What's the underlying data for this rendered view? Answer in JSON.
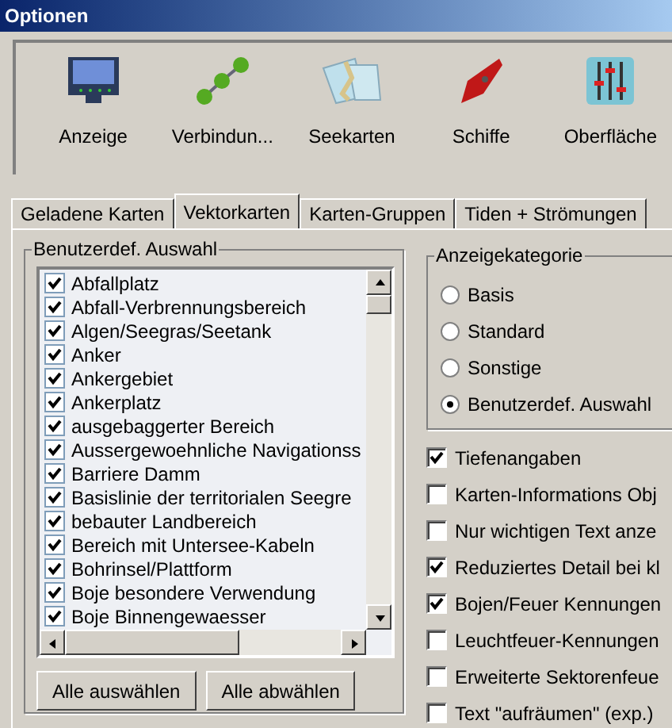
{
  "window": {
    "title": "Optionen"
  },
  "toolbar": [
    {
      "label": "Anzeige",
      "kind": "monitor"
    },
    {
      "label": "Verbindun...",
      "kind": "nodes"
    },
    {
      "label": "Seekarten",
      "kind": "maps"
    },
    {
      "label": "Schiffe",
      "kind": "boat"
    },
    {
      "label": "Oberfläche",
      "kind": "sliders"
    }
  ],
  "tabs": [
    {
      "label": "Geladene Karten",
      "selected": false
    },
    {
      "label": "Vektorkarten",
      "selected": true
    },
    {
      "label": "Karten-Gruppen",
      "selected": false
    },
    {
      "label": "Tiden + Strömungen",
      "selected": false
    }
  ],
  "custom_selection": {
    "title": "Benutzerdef. Auswahl",
    "items": [
      {
        "label": "Abfallplatz",
        "checked": true
      },
      {
        "label": "Abfall-Verbrennungsbereich",
        "checked": true
      },
      {
        "label": "Algen/Seegras/Seetank",
        "checked": true
      },
      {
        "label": "Anker",
        "checked": true
      },
      {
        "label": "Ankergebiet",
        "checked": true
      },
      {
        "label": "Ankerplatz",
        "checked": true
      },
      {
        "label": "ausgebaggerter Bereich",
        "checked": true
      },
      {
        "label": "Aussergewoehnliche Navigationss",
        "checked": true
      },
      {
        "label": "Barriere Damm",
        "checked": true
      },
      {
        "label": "Basislinie der territorialen Seegre",
        "checked": true
      },
      {
        "label": "bebauter Landbereich",
        "checked": true
      },
      {
        "label": "Bereich mit Untersee-Kabeln",
        "checked": true
      },
      {
        "label": "Bohrinsel/Plattform",
        "checked": true
      },
      {
        "label": "Boje besondere Verwendung",
        "checked": true
      },
      {
        "label": "Boje Binnengewaesser",
        "checked": true
      }
    ],
    "buttons": [
      "Alle auswählen",
      "Alle abwählen"
    ]
  },
  "display_category": {
    "title": "Anzeigekategorie",
    "options": [
      {
        "label": "Basis",
        "selected": false
      },
      {
        "label": "Standard",
        "selected": false
      },
      {
        "label": "Sonstige",
        "selected": false
      },
      {
        "label": "Benutzerdef. Auswahl",
        "selected": true
      }
    ]
  },
  "options": [
    {
      "label": "Tiefenangaben",
      "checked": true
    },
    {
      "label": "Karten-Informations Obj",
      "checked": false
    },
    {
      "label": "Nur wichtigen Text anze",
      "checked": false
    },
    {
      "label": "Reduziertes Detail bei kl",
      "checked": true
    },
    {
      "label": "Bojen/Feuer Kennungen",
      "checked": true
    },
    {
      "label": "Leuchtfeuer-Kennungen",
      "checked": false
    },
    {
      "label": "Erweiterte Sektorenfeue",
      "checked": false
    },
    {
      "label": "Text \"aufräumen\" (exp.)",
      "checked": false
    }
  ]
}
